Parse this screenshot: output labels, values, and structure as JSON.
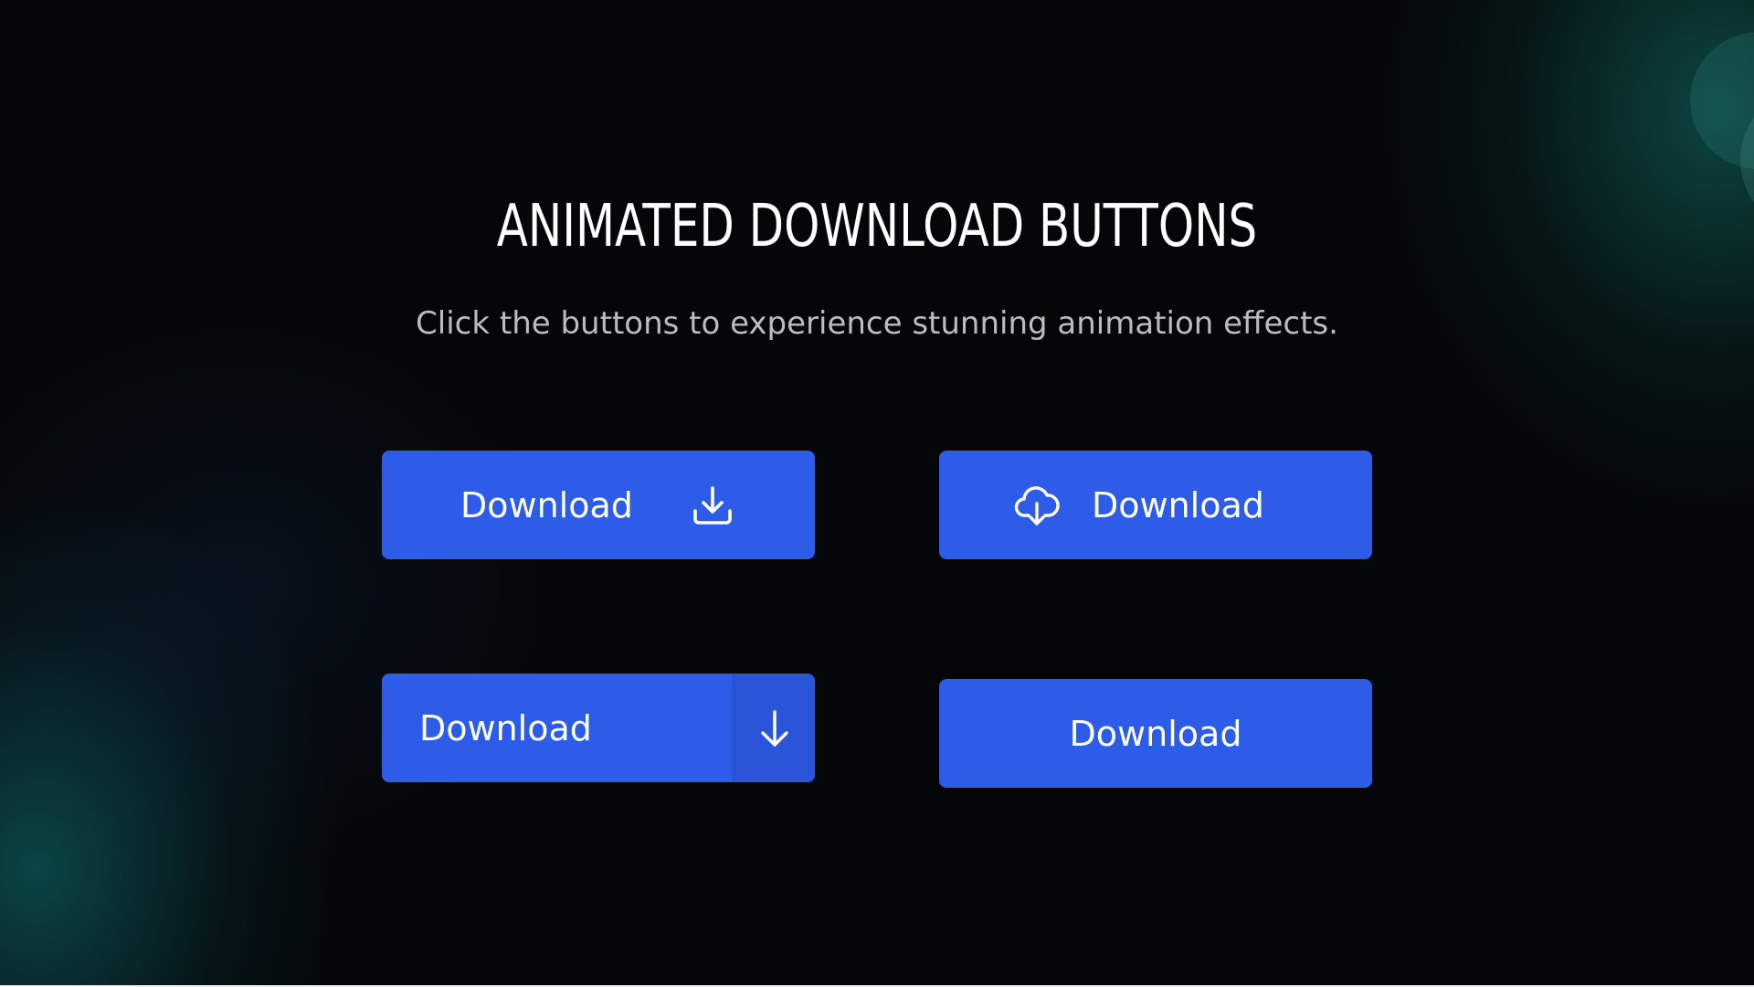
{
  "page": {
    "title": "ANIMATED DOWNLOAD BUTTONS",
    "subtitle": "Click the buttons to experience stunning animation effects."
  },
  "buttons": [
    {
      "label": "Download",
      "icon": "download-tray-icon"
    },
    {
      "label": "Download",
      "icon": "cloud-download-icon"
    },
    {
      "label": "Download",
      "icon": "arrow-down-icon"
    },
    {
      "label": "Download",
      "icon": ""
    }
  ],
  "colors": {
    "background": "#050608",
    "button": "#2d5ce8",
    "accent_glow": "#1a7a70",
    "title": "#ffffff",
    "subtitle": "#b8bcc4"
  }
}
